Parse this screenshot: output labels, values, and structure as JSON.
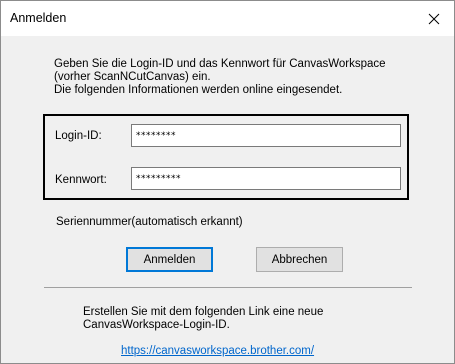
{
  "window": {
    "title": "Anmelden",
    "close_symbol": "close-icon"
  },
  "description": {
    "line1": "Geben Sie die Login-ID und das Kennwort für CanvasWorkspace",
    "line2": "(vorher ScanNCutCanvas) ein.",
    "line3": "Die folgenden Informationen werden online eingesendet."
  },
  "form": {
    "login_label": "Login-ID:",
    "login_value": "********",
    "password_label": "Kennwort:",
    "password_value": "*********"
  },
  "serial_label": "Seriennummer(automatisch erkannt)",
  "buttons": {
    "login": "Anmelden",
    "cancel": "Abbrechen"
  },
  "info": {
    "line1": "Erstellen Sie mit dem folgenden Link eine neue",
    "line2": "CanvasWorkspace-Login-ID.",
    "link": "https://canvasworkspace.brother.com/"
  }
}
